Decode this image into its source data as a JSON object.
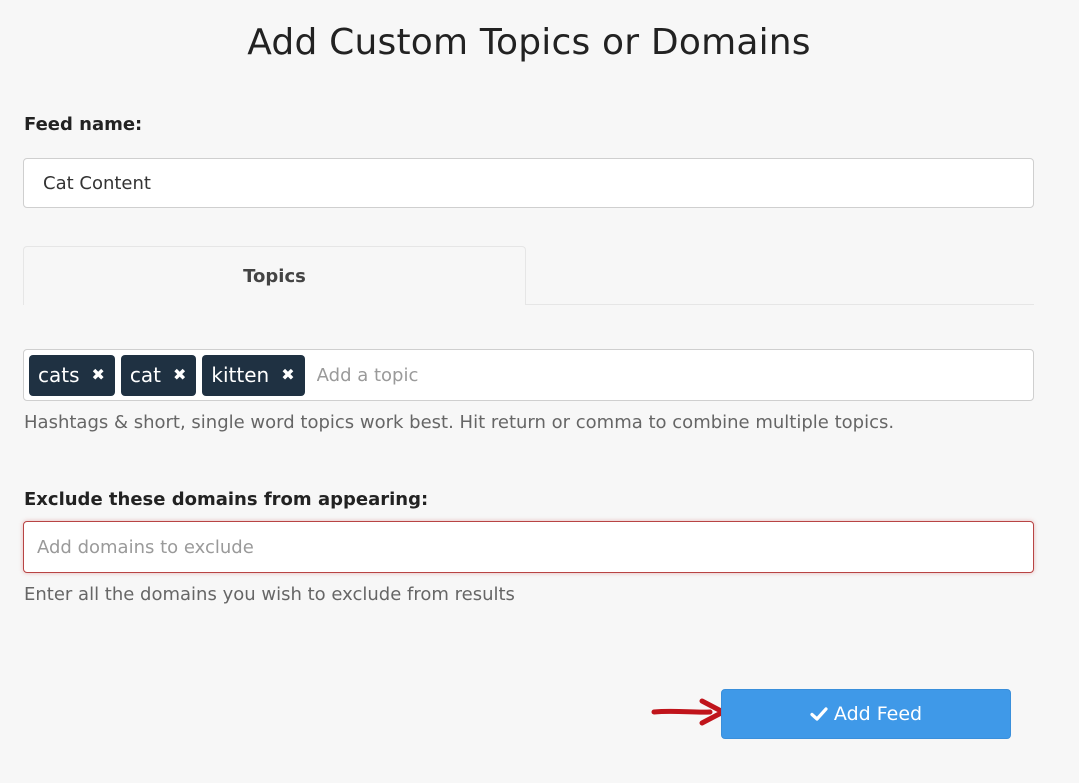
{
  "page": {
    "title": "Add Custom Topics or Domains"
  },
  "feed_name": {
    "label": "Feed name:",
    "value": "Cat Content"
  },
  "tabs": [
    {
      "label": "Topics",
      "active": true
    }
  ],
  "topics": {
    "tags": [
      {
        "label": "cats",
        "remove_icon": "close-icon"
      },
      {
        "label": "cat",
        "remove_icon": "close-icon"
      },
      {
        "label": "kitten",
        "remove_icon": "close-icon"
      }
    ],
    "placeholder": "Add a topic",
    "help": "Hashtags & short, single word topics work best. Hit return or comma to combine multiple topics."
  },
  "exclude": {
    "label": "Exclude these domains from appearing:",
    "placeholder": "Add domains to exclude",
    "help": "Enter all the domains you wish to exclude from results"
  },
  "actions": {
    "add_feed_label": "Add Feed",
    "add_feed_icon": "check-icon"
  },
  "colors": {
    "tag_bg": "#1f3142",
    "button_bg": "#3f99e8",
    "arrow": "#c0141b",
    "error_border": "#b84444"
  }
}
